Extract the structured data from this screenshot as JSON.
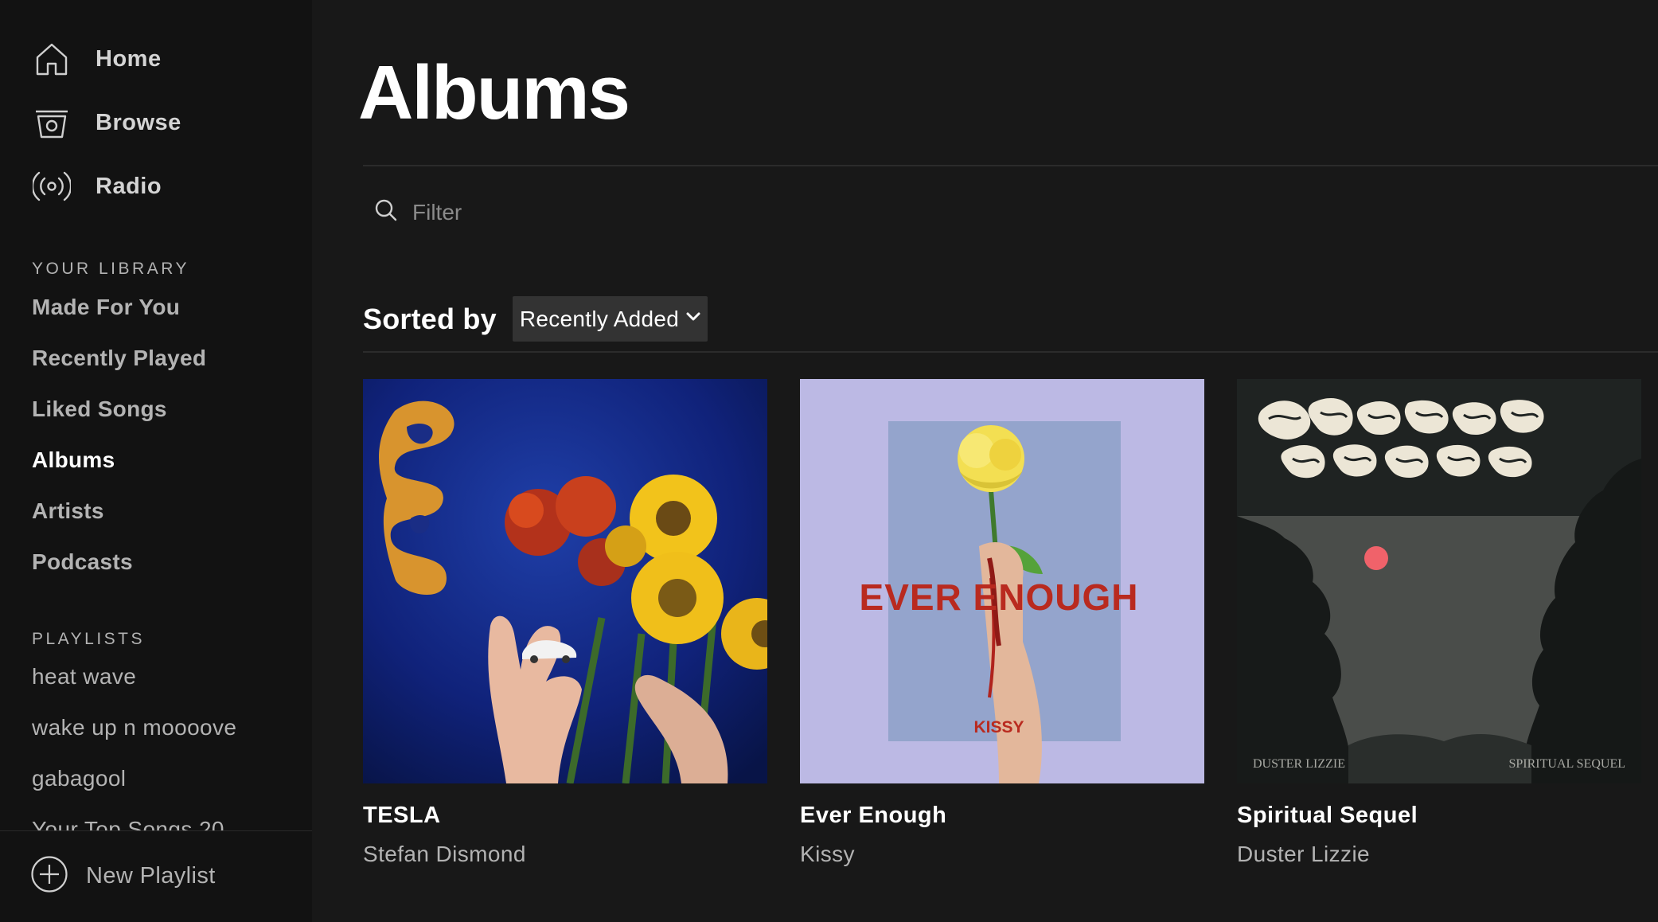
{
  "sidebar": {
    "nav": [
      {
        "label": "Home",
        "icon": "home-icon"
      },
      {
        "label": "Browse",
        "icon": "browse-icon"
      },
      {
        "label": "Radio",
        "icon": "radio-icon"
      }
    ],
    "library_header": "YOUR LIBRARY",
    "library": [
      {
        "label": "Made For You"
      },
      {
        "label": "Recently Played"
      },
      {
        "label": "Liked Songs"
      },
      {
        "label": "Albums",
        "active": true
      },
      {
        "label": "Artists"
      },
      {
        "label": "Podcasts"
      }
    ],
    "playlists_header": "PLAYLISTS",
    "playlists": [
      {
        "label": "heat wave"
      },
      {
        "label": "wake up n moooove"
      },
      {
        "label": "gabagool"
      },
      {
        "label": "Your Top Songs 20"
      }
    ],
    "new_playlist_label": "New Playlist"
  },
  "main": {
    "title": "Albums",
    "filter": {
      "placeholder": "Filter",
      "value": ""
    },
    "sort": {
      "label": "Sorted by",
      "selected": "Recently Added"
    },
    "albums": [
      {
        "title": "TESLA",
        "artist": "Stefan Dismond"
      },
      {
        "title": "Ever Enough",
        "artist": "Kissy",
        "cover_text": "EVER ENOUGH",
        "cover_subtext": "KISSY"
      },
      {
        "title": "Spiritual Sequel",
        "artist": "Duster Lizzie",
        "cover_left_text": "DUSTER LIZZIE",
        "cover_right_text": "SPIRITUAL SEQUEL"
      }
    ]
  },
  "colors": {
    "sidebar_bg": "#121212",
    "main_bg": "#181818",
    "text_primary": "#ffffff",
    "text_secondary": "#b3b3b3",
    "select_bg": "#333333"
  }
}
